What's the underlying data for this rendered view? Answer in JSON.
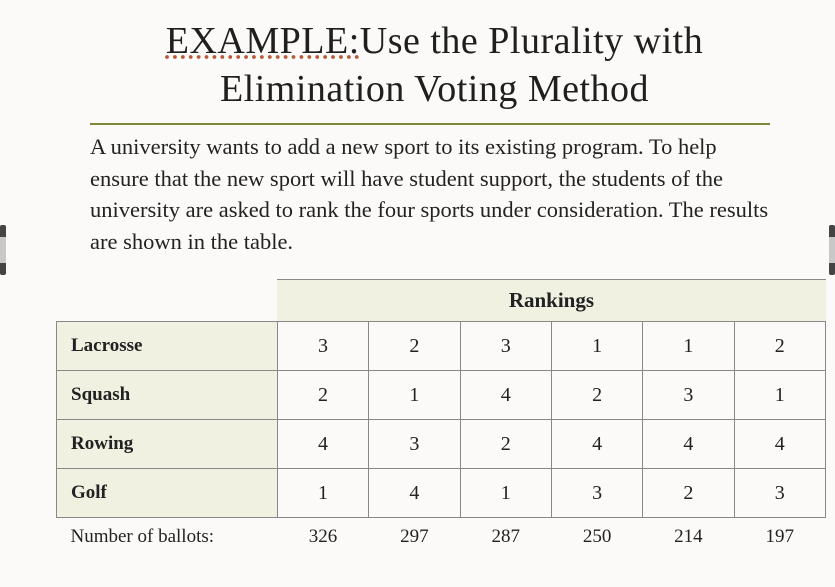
{
  "title": {
    "example_label": "EXAMPLE:",
    "rest": "Use the Plurality with Elimination Voting Method"
  },
  "paragraph": "A university wants to add a new sport to its existing program. To help ensure that the new sport will have student support, the students of the university are asked to rank the four sports under consideration. The results are shown in the table.",
  "table": {
    "rankings_header": "Rankings",
    "rows": [
      {
        "label": "Lacrosse",
        "values": [
          "3",
          "2",
          "3",
          "1",
          "1",
          "2"
        ]
      },
      {
        "label": "Squash",
        "values": [
          "2",
          "1",
          "4",
          "2",
          "3",
          "1"
        ]
      },
      {
        "label": "Rowing",
        "values": [
          "4",
          "3",
          "2",
          "4",
          "4",
          "4"
        ]
      },
      {
        "label": "Golf",
        "values": [
          "1",
          "4",
          "1",
          "3",
          "2",
          "3"
        ]
      }
    ],
    "footer_label": "Number of ballots:",
    "footer_values": [
      "326",
      "297",
      "287",
      "250",
      "214",
      "197"
    ]
  }
}
